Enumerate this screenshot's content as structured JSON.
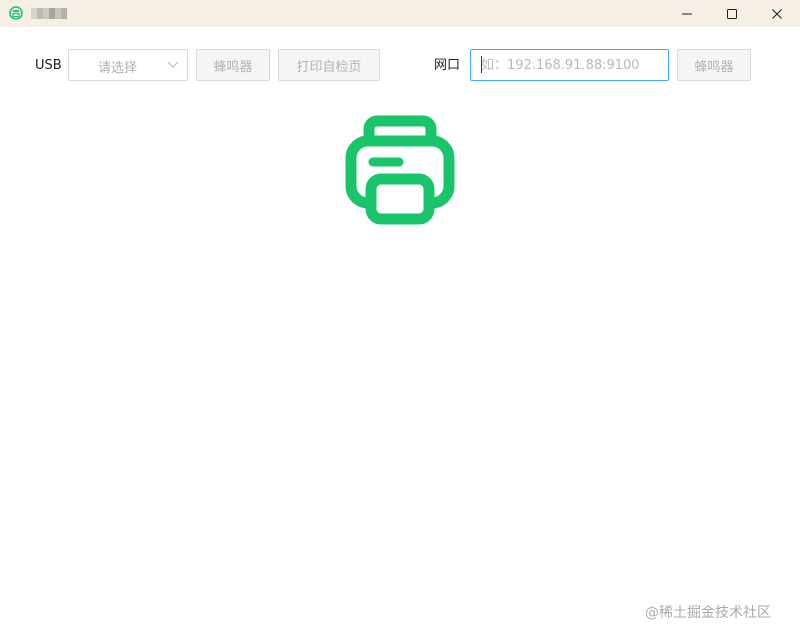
{
  "window": {
    "title": "",
    "min_icon": "minimize-icon",
    "max_icon": "maximize-icon",
    "close_icon": "close-icon"
  },
  "toolbar": {
    "usb_label": "USB",
    "usb_select": {
      "placeholder": "请选择"
    },
    "usb_buzzer_button": "蜂鸣器",
    "self_test_button": "打印自检页",
    "network_label": "网口",
    "network_input": {
      "value": "",
      "placeholder": "如：192.168.91.88:9100"
    },
    "network_buzzer_button": "蜂鸣器"
  },
  "main": {
    "icon": "printer-icon",
    "icon_color": "#19c46a"
  },
  "watermark": "@稀土掘金技术社区",
  "colors": {
    "accent": "#19c46a",
    "titlebar": "#f6efe5",
    "input_focus_border": "#40a9ff"
  }
}
